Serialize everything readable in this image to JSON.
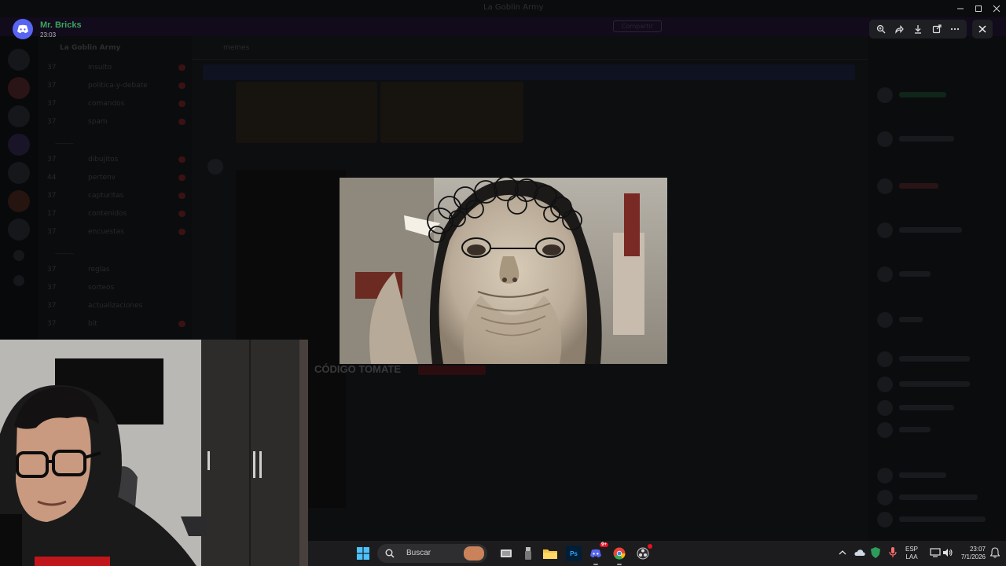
{
  "background": {
    "window_title": "La Goblin Army",
    "banner_text": "Discord Nitro promo banner",
    "banner_button": "Compartir",
    "server_name": "La Goblin Army",
    "channels": [
      {
        "num": "37",
        "label": "insulto"
      },
      {
        "num": "37",
        "label": "politica-y-debate"
      },
      {
        "num": "37",
        "label": "comandos"
      },
      {
        "num": "37",
        "label": "spam"
      },
      {
        "num": "37",
        "label": "dibujitos"
      },
      {
        "num": "44",
        "label": "pertenv"
      },
      {
        "num": "37",
        "label": "capturitas"
      },
      {
        "num": "17",
        "label": "contenidos"
      },
      {
        "num": "37",
        "label": "encuestas"
      },
      {
        "num": "37",
        "label": "reglas"
      },
      {
        "num": "37",
        "label": "sorteos"
      },
      {
        "num": "37",
        "label": "actualizaciones"
      },
      {
        "num": "37",
        "label": "bit"
      }
    ],
    "chat_channel": "memes",
    "code_tomate": "CÓDIGO TOMATE"
  },
  "viewer": {
    "username": "Mr. Bricks",
    "time": "23:03",
    "tools": [
      "zoom-icon",
      "forward-icon",
      "download-icon",
      "open-external-icon",
      "more-icon"
    ],
    "close_icon": "close-icon"
  },
  "taskbar": {
    "search_placeholder": "Buscar",
    "lang_line1": "ESP",
    "lang_line2": "LAA",
    "time": "23:07",
    "date": "7/1/2026",
    "discord_badge": "9+"
  },
  "colors": {
    "discord_blurple": "#5865f2",
    "username_green": "#3ba55d"
  }
}
